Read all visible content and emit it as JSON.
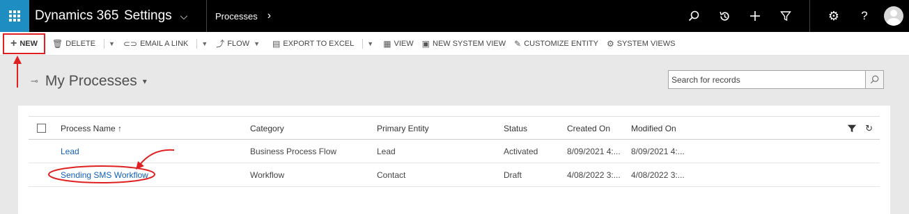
{
  "topbar": {
    "brand": "Dynamics 365",
    "area": "Settings",
    "breadcrumb": "Processes"
  },
  "commandbar": {
    "new": "NEW",
    "delete": "DELETE",
    "email_link": "EMAIL A LINK",
    "flow": "FLOW",
    "export_excel": "EXPORT TO EXCEL",
    "view": "VIEW",
    "new_system_view": "NEW SYSTEM VIEW",
    "customize_entity": "CUSTOMIZE ENTITY",
    "system_views": "SYSTEM VIEWS"
  },
  "view": {
    "title": "My Processes",
    "search_placeholder": "Search for records"
  },
  "grid": {
    "columns": {
      "name": "Process Name ↑",
      "category": "Category",
      "entity": "Primary Entity",
      "status": "Status",
      "created": "Created On",
      "modified": "Modified On"
    },
    "rows": [
      {
        "name": "Lead",
        "category": "Business Process Flow",
        "entity": "Lead",
        "status": "Activated",
        "created": "8/09/2021 4:...",
        "modified": "8/09/2021 4:..."
      },
      {
        "name": "Sending SMS Workflow",
        "category": "Workflow",
        "entity": "Contact",
        "status": "Draft",
        "created": "4/08/2022 3:...",
        "modified": "4/08/2022 3:..."
      }
    ]
  },
  "annotation_color": "#e02020",
  "accent_color": "#1e8dc2",
  "link_color": "#1160b7"
}
